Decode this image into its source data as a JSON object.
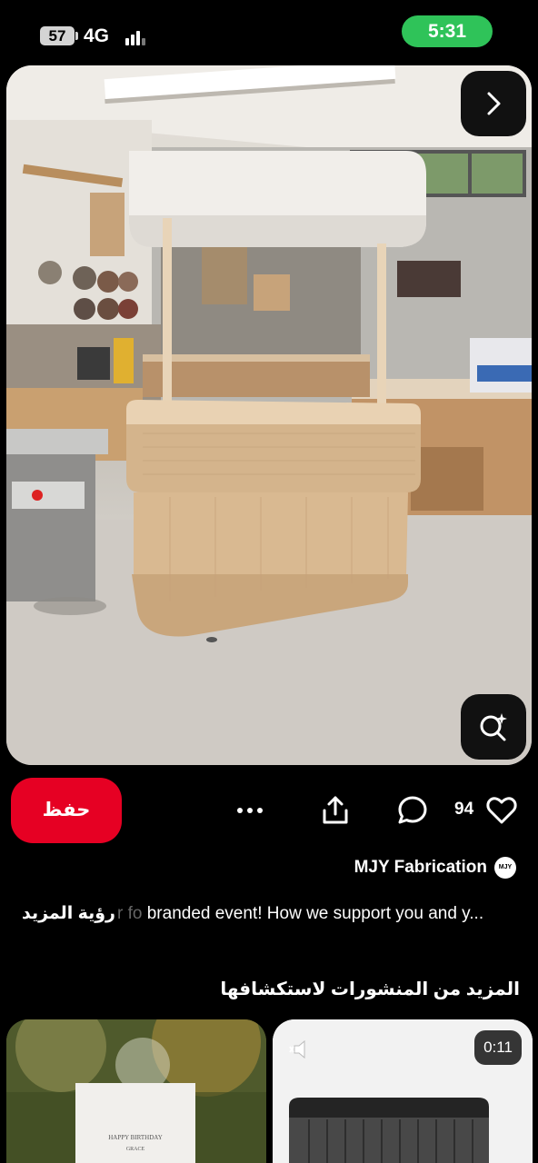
{
  "status_bar": {
    "battery": "57",
    "network": "4G",
    "time": "5:31"
  },
  "pin": {
    "image_alt": "Curved oak wood kiosk booth with canopy in a woodworking shop",
    "next_icon": "chevron-right-icon",
    "lens_icon": "visual-search-icon"
  },
  "actions": {
    "save_label": "حفظ",
    "more_icon": "ellipsis-icon",
    "share_icon": "share-icon",
    "comment_icon": "comment-icon",
    "likes": "94",
    "like_icon": "heart-icon"
  },
  "creator": {
    "name": "MJY Fabrication",
    "avatar_text": "MJY"
  },
  "description": {
    "see_more": "رؤية المزيد",
    "faded": "r fo",
    "text": "branded event! How we support you and y..."
  },
  "more_section": {
    "title": "المزيد من المنشورات لاستكشافها"
  },
  "thumbnails": [
    {
      "banner_line1": "HAPPY BIRTHDAY",
      "banner_line2": "GRACE"
    },
    {
      "duration": "0:11",
      "mute_icon": "muted-speaker-icon"
    }
  ],
  "colors": {
    "save_red": "#e60023",
    "clock_green": "#2fc359",
    "background": "#000000"
  }
}
